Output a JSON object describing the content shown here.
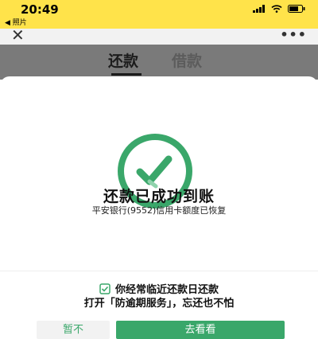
{
  "status_bar": {
    "time": "20:49",
    "back_app": "◀ 照片"
  },
  "nav": {
    "close": "✕",
    "more": "•••"
  },
  "tabs": [
    {
      "label": "还款",
      "active": true
    },
    {
      "label": "借款",
      "active": false
    }
  ],
  "result": {
    "title": "还款已成功到账",
    "subtitle": "平安银行(9552)信用卡额度已恢复"
  },
  "promo": {
    "line1": "你经常临近还款日还款",
    "line2": "打开「防逾期服务」，忘还也不怕"
  },
  "buttons": {
    "dismiss": "暂不",
    "go": "去看看"
  },
  "colors": {
    "accent": "#3aa76a",
    "status_bar": "#ffe34a"
  }
}
